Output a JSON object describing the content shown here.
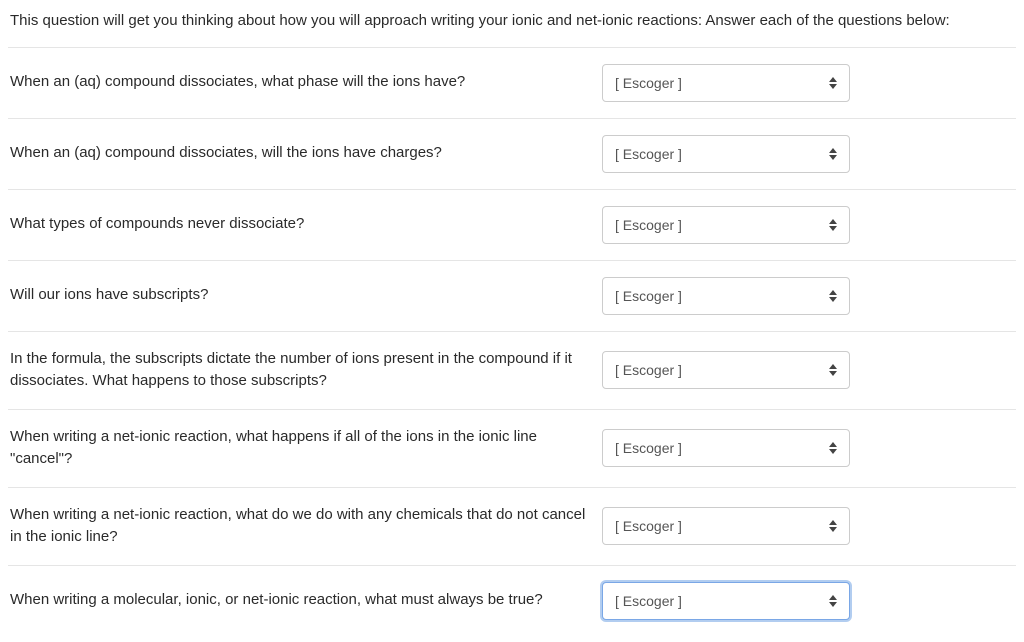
{
  "intro": "This question will get you thinking about how you will approach writing your ionic and net-ionic reactions: Answer each of the questions below:",
  "select_placeholder": "[ Escoger ]",
  "questions": [
    {
      "label": "When an (aq) compound dissociates, what phase will the ions have?",
      "focused": false
    },
    {
      "label": "When an (aq) compound dissociates, will the ions have charges?",
      "focused": false
    },
    {
      "label": "What types of compounds never dissociate?",
      "focused": false
    },
    {
      "label": "Will our ions have subscripts?",
      "focused": false
    },
    {
      "label": "In the formula, the subscripts dictate the number of ions present in the compound if it dissociates. What happens to those subscripts?",
      "focused": false
    },
    {
      "label": "When writing a net-ionic reaction, what happens if all of the ions in the ionic line \"cancel\"?",
      "focused": false
    },
    {
      "label": "When writing a net-ionic reaction, what do we do with any chemicals that do not cancel in the ionic line?",
      "focused": false
    },
    {
      "label": "When writing a molecular, ionic, or net-ionic reaction, what must always be true?",
      "focused": true
    }
  ]
}
